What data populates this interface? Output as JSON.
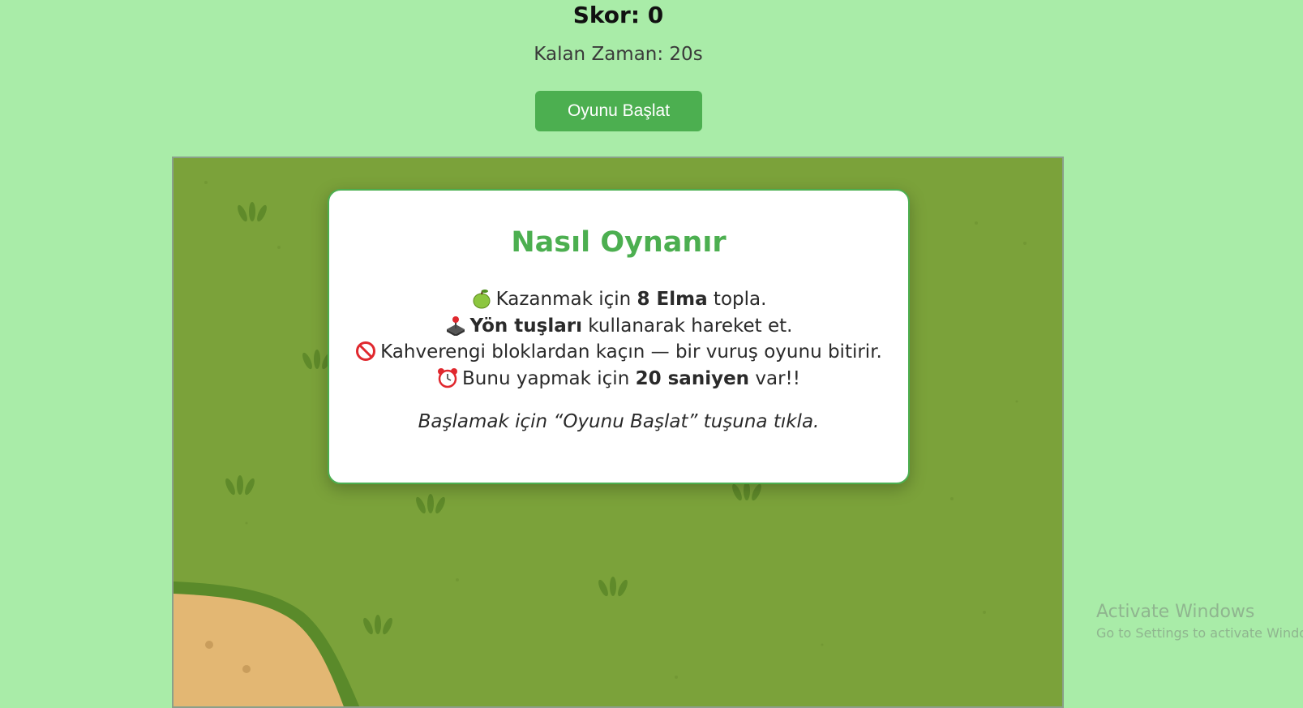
{
  "header": {
    "score_text": "Skor: 0",
    "timer_text": "Kalan Zaman: 20s",
    "start_button_label": "Oyunu Başlat"
  },
  "modal": {
    "title": "Nasıl Oynanır",
    "rules": [
      {
        "icon": "green-apple-icon",
        "before": "Kazanmak için ",
        "bold": "8 Elma",
        "after": " topla."
      },
      {
        "icon": "joystick-icon",
        "before": "",
        "bold": "Yön tuşları",
        "after": " kullanarak hareket et."
      },
      {
        "icon": "prohibited-icon",
        "before": "Kahverengi bloklardan kaçın — bir vuruş oyunu bitirir.",
        "bold": "",
        "after": ""
      },
      {
        "icon": "alarm-clock-icon",
        "before": "Bunu yapmak için ",
        "bold": "20 saniyen",
        "after": " var!!"
      }
    ],
    "hint": "Başlamak için “Oyunu Başlat” tuşuna tıkla."
  },
  "watermark": {
    "line1": "Activate Windows",
    "line2": "Go to Settings to activate Windows."
  },
  "colors": {
    "page_bg": "#a9eca8",
    "accent": "#4caf50",
    "grass": "#7ba23a",
    "sand": "#e3b773"
  }
}
